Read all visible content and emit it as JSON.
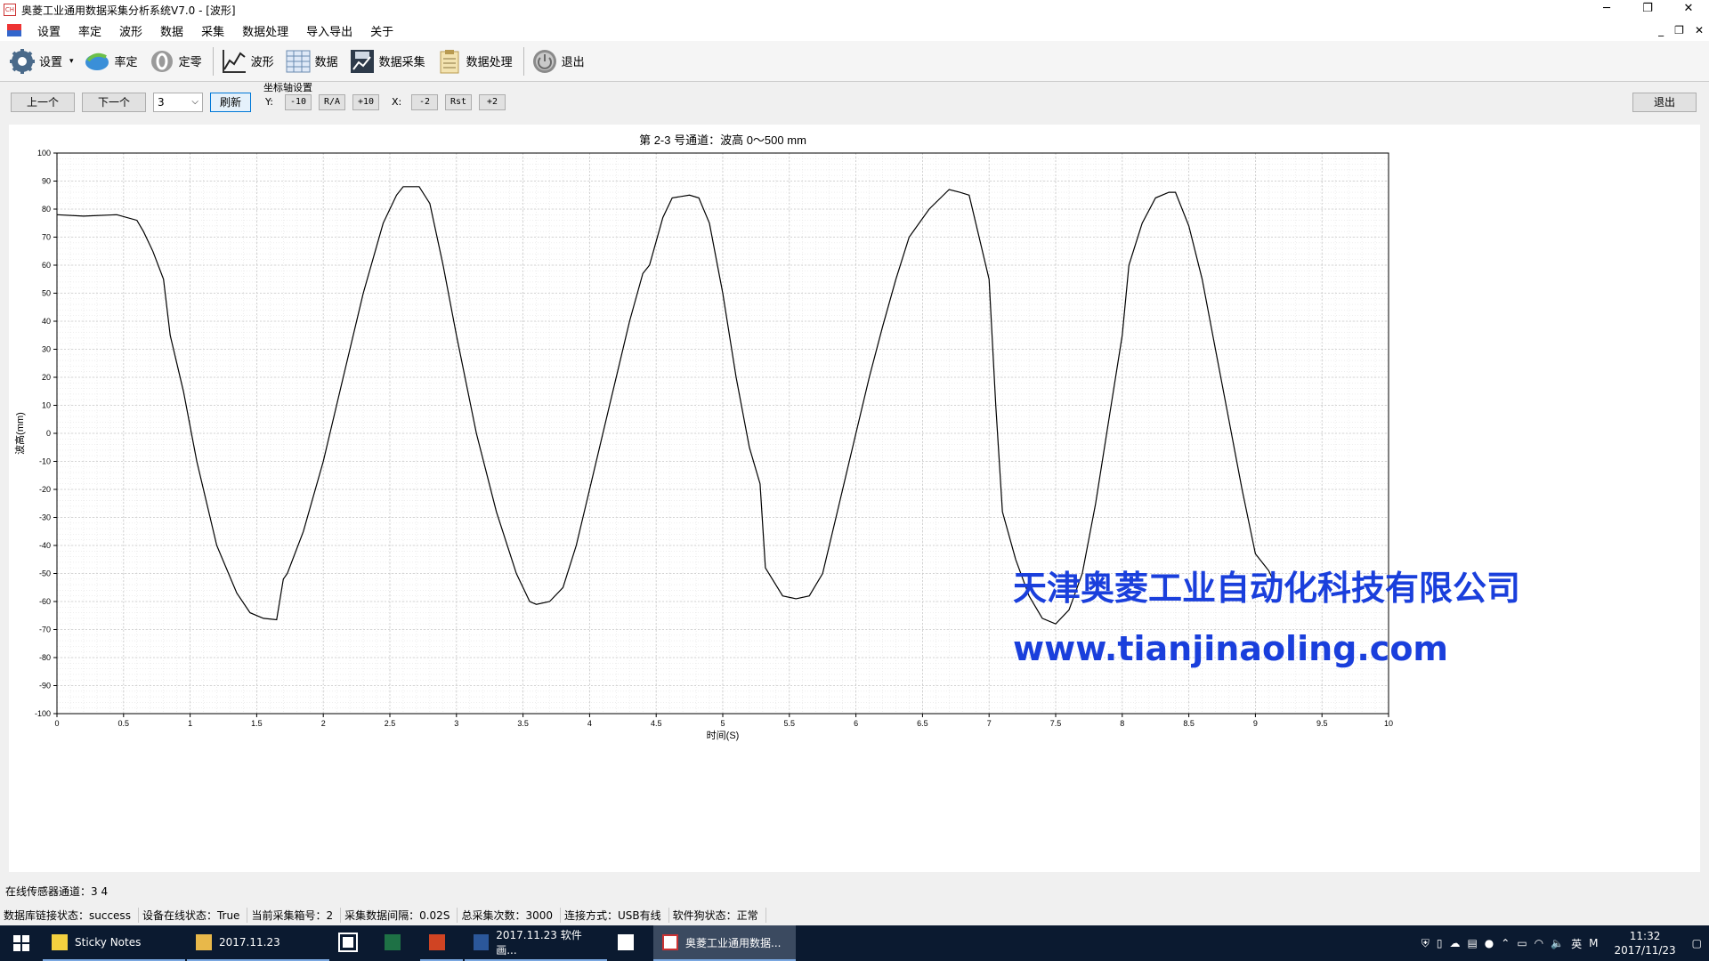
{
  "window": {
    "title": "奥菱工业通用数据采集分析系统V7.0 - [波形]",
    "app_icon": "app-logo-icon",
    "minimize": "─",
    "maximize": "❐",
    "close": "✕"
  },
  "menu": [
    "设置",
    "率定",
    "波形",
    "数据",
    "采集",
    "数据处理",
    "导入导出",
    "关于"
  ],
  "mdi_controls": [
    "_",
    "❐",
    "✕"
  ],
  "toolbar": [
    {
      "label": "设置",
      "icon": "gear-icon"
    },
    {
      "label": "率定",
      "icon": "calibrate-icon"
    },
    {
      "label": "定零",
      "icon": "zero-icon"
    },
    {
      "label": "波形",
      "icon": "waveform-icon"
    },
    {
      "label": "数据",
      "icon": "table-icon"
    },
    {
      "label": "数据采集",
      "icon": "acquisition-icon"
    },
    {
      "label": "数据处理",
      "icon": "clipboard-icon"
    },
    {
      "label": "退出",
      "icon": "power-icon"
    }
  ],
  "controls": {
    "prev": "上一个",
    "next": "下一个",
    "channel_value": "3",
    "refresh": "刷新",
    "axis_group_label": "坐标轴设置",
    "y_label": "Y:",
    "y_minus": "-10",
    "y_ra": "R/A",
    "y_plus": "+10",
    "x_label": "X:",
    "x_minus": "-2",
    "x_rst": "Rst",
    "x_plus": "+2",
    "exit": "退出"
  },
  "chart_data": {
    "type": "line",
    "title": "第 2-3 号通道：波高 0～500 mm",
    "xlabel": "时间(S)",
    "ylabel": "波高(mm)",
    "xlim": [
      0,
      10
    ],
    "ylim": [
      -100,
      100
    ],
    "xticks": [
      "0",
      "0.5",
      "1",
      "1.5",
      "2",
      "2.5",
      "3",
      "3.5",
      "4",
      "4.5",
      "5",
      "5.5",
      "6",
      "6.5",
      "7",
      "7.5",
      "8",
      "8.5",
      "9",
      "9.5",
      "10"
    ],
    "yticks": [
      "100",
      "90",
      "80",
      "70",
      "60",
      "50",
      "40",
      "30",
      "20",
      "10",
      "0",
      "-10",
      "-20",
      "-30",
      "-40",
      "-50",
      "-60",
      "-70",
      "-80",
      "-90",
      "-100"
    ],
    "grid": true,
    "series": [
      {
        "color": "#000000",
        "x": [
          0,
          0.2,
          0.45,
          0.6,
          0.65,
          0.72,
          0.8,
          0.85,
          0.95,
          1.05,
          1.2,
          1.35,
          1.45,
          1.55,
          1.65,
          1.7,
          1.73,
          1.85,
          2.0,
          2.15,
          2.3,
          2.45,
          2.55,
          2.6,
          2.72,
          2.8,
          2.9,
          3.0,
          3.15,
          3.3,
          3.45,
          3.5,
          3.55,
          3.6,
          3.7,
          3.8,
          3.9,
          4.0,
          4.15,
          4.3,
          4.4,
          4.45,
          4.55,
          4.62,
          4.75,
          4.82,
          4.9,
          5.0,
          5.1,
          5.2,
          5.28,
          5.32,
          5.45,
          5.55,
          5.65,
          5.75,
          5.85,
          6.0,
          6.1,
          6.2,
          6.3,
          6.4,
          6.55,
          6.7,
          6.78,
          6.85,
          7.0,
          7.05,
          7.1,
          7.2,
          7.3,
          7.4,
          7.5,
          7.6,
          7.7,
          7.8,
          7.9,
          8.0,
          8.05,
          8.15,
          8.25,
          8.35,
          8.4,
          8.5,
          8.6,
          8.7,
          8.8,
          8.9,
          9.0,
          9.1,
          9.13
        ],
        "y": [
          78,
          77.5,
          78,
          76,
          72,
          65,
          55,
          35,
          15,
          -10,
          -40,
          -57,
          -64,
          -66,
          -66.5,
          -52,
          -50,
          -35,
          -10,
          20,
          50,
          75,
          85,
          88,
          88,
          82,
          60,
          35,
          0,
          -28,
          -50,
          -55,
          -60,
          -61,
          -60,
          -55,
          -40,
          -20,
          10,
          40,
          57,
          60,
          77,
          84,
          85,
          84,
          75,
          50,
          20,
          -5,
          -18,
          -48,
          -58,
          -59,
          -58,
          -50,
          -30,
          0,
          20,
          38,
          55,
          70,
          80,
          87,
          86,
          85,
          55,
          10,
          -28,
          -45,
          -58,
          -66,
          -68,
          -63,
          -50,
          -25,
          5,
          35,
          60,
          75,
          84,
          86,
          86,
          74,
          55,
          30,
          5,
          -20,
          -43,
          -49,
          -52
        ]
      }
    ]
  },
  "watermark": {
    "company": "天津奥菱工业自动化科技有限公司",
    "url": "www.tianjinaoling.com",
    "color": "#1a3fdc"
  },
  "online_channels": "在线传感器通道：3 4",
  "status": [
    "数据库链接状态：success",
    "设备在线状态：True",
    "当前采集箱号：2",
    "采集数据间隔：0.02S",
    "总采集次数：3000",
    "连接方式：USB有线",
    "软件狗状态：正常"
  ],
  "taskbar": {
    "apps": [
      {
        "label": "Sticky Notes",
        "icon": "sticky-notes-icon",
        "color": "#f4d03f"
      },
      {
        "label": "2017.11.23",
        "icon": "folder-icon",
        "color": "#e8b84a"
      },
      {
        "label": "",
        "icon": "store-icon",
        "color": "#ffffff"
      },
      {
        "label": "",
        "icon": "excel-icon",
        "color": "#1e7145"
      },
      {
        "label": "",
        "icon": "powerpoint-icon",
        "color": "#d04423"
      },
      {
        "label": "2017.11.23 软件画...",
        "icon": "word-icon",
        "color": "#2b579a"
      },
      {
        "label": "",
        "icon": "mail-icon",
        "color": "#ffffff"
      },
      {
        "label": "奥菱工业通用数据...",
        "icon": "app-logo-icon",
        "color": "#ffffff"
      }
    ],
    "ime": "英",
    "ime2": "M",
    "time": "11:32",
    "date": "2017/11/23"
  }
}
